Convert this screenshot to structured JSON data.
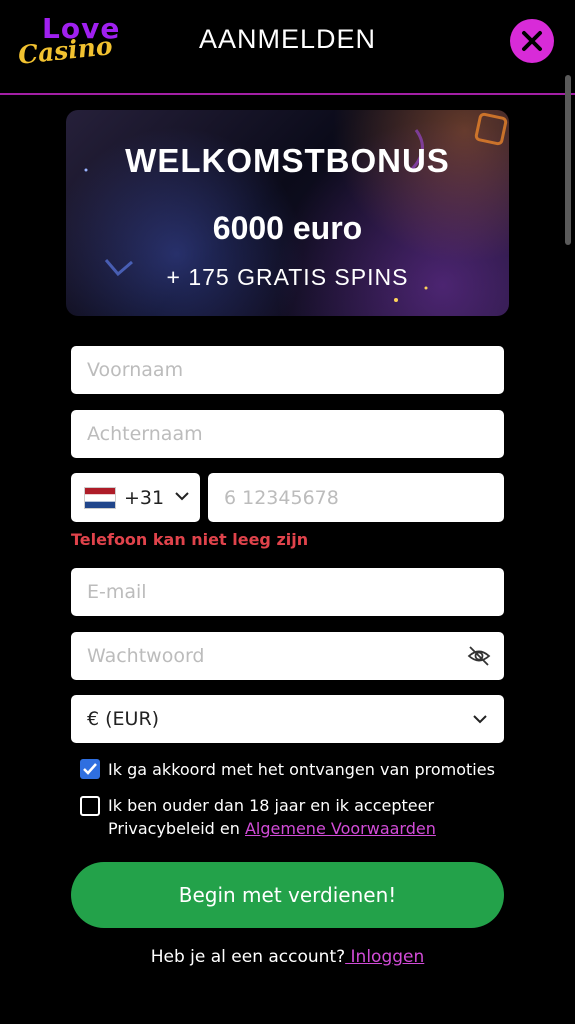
{
  "header": {
    "logo_top": "Love",
    "logo_bottom": "Casino",
    "title": "AANMELDEN",
    "close_icon": "close-icon"
  },
  "banner": {
    "title": "WELKOMSTBONUS",
    "amount": "6000 euro",
    "spins": "+ 175 GRATIS SPINS"
  },
  "form": {
    "first_name_placeholder": "Voornaam",
    "last_name_placeholder": "Achternaam",
    "country_code": "+31",
    "phone_placeholder": "6 12345678",
    "phone_error": "Telefoon kan niet leeg zijn",
    "email_placeholder": "E-mail",
    "password_placeholder": "Wachtwoord",
    "currency": "€ (EUR)",
    "promo_label": "Ik ga akkoord met het ontvangen van promoties",
    "promo_checked": true,
    "age_label_line1": "Ik ben ouder dan 18 jaar en ik accepteer",
    "age_label_line2": "Privacybeleid en ",
    "terms_link": "Algemene Voorwaarden",
    "age_checked": false,
    "submit": "Begin met verdienen!"
  },
  "footer": {
    "have_account": "Heb je al een account?",
    "login_link": " Inloggen"
  },
  "colors": {
    "accent": "#d82bd8",
    "submit": "#23a24a",
    "error": "#e0434b"
  }
}
